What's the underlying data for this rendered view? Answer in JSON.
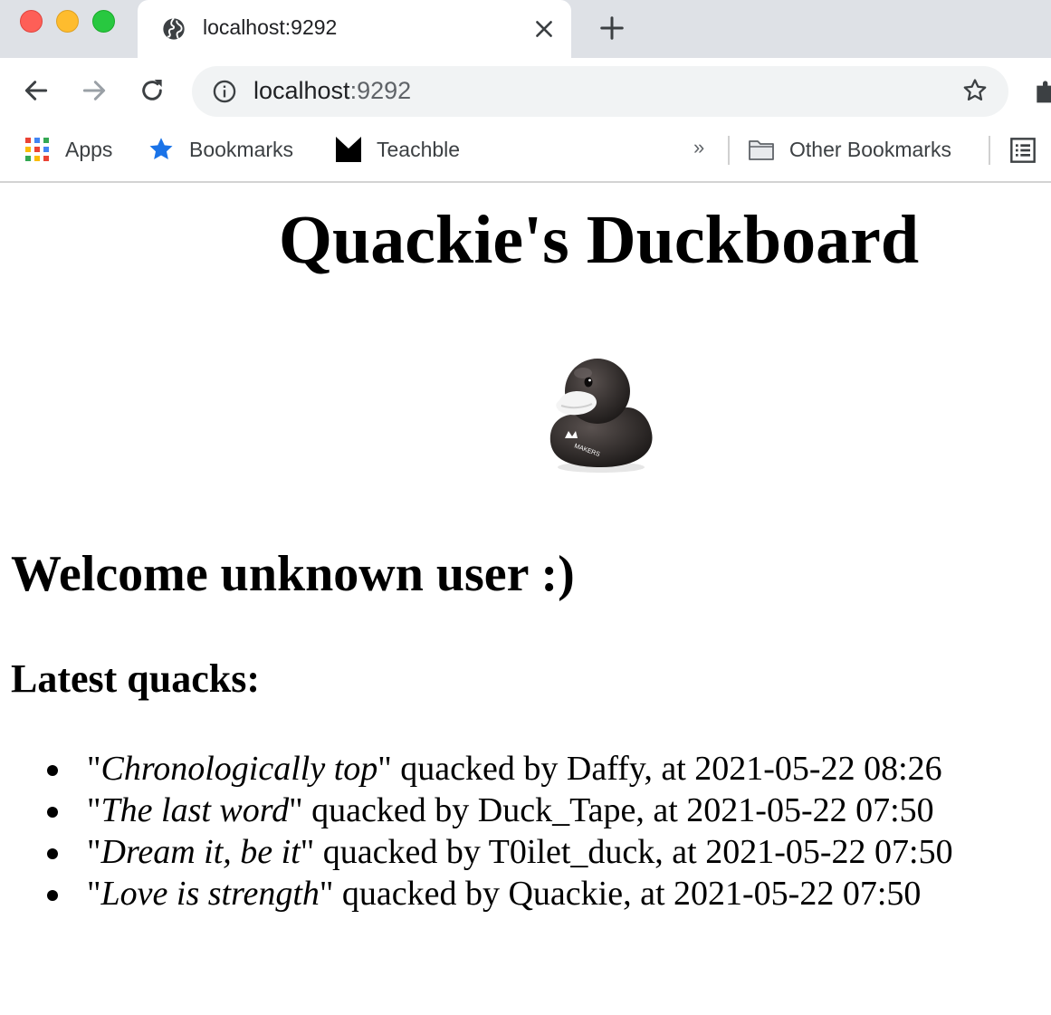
{
  "browser": {
    "tab": {
      "title": "localhost:9292"
    },
    "address_bar": {
      "host": "localhost",
      "port": ":9292"
    },
    "bookmarks_bar": {
      "items": [
        {
          "label": "Apps",
          "icon": "apps-grid-icon"
        },
        {
          "label": "Bookmarks",
          "icon": "star-icon"
        },
        {
          "label": "Teachble",
          "icon": "teachable-logo-icon"
        }
      ],
      "overflow": "»",
      "other": {
        "label": "Other Bookmarks",
        "icon": "folder-icon"
      }
    },
    "colors": {
      "tabstrip": "#dee1e6",
      "omnibox": "#f1f3f4",
      "star_blue": "#1a73e8"
    }
  },
  "page": {
    "title": "Quackie's Duckboard",
    "welcome": "Welcome unknown user :)",
    "latest_heading": "Latest quacks:",
    "quacks": [
      {
        "open_quote": "\"",
        "text": "Chronologically top",
        "close_quote": "\"",
        "rest": " quacked by Daffy, at 2021-05-22 08:26"
      },
      {
        "open_quote": "\"",
        "text": "The last word",
        "close_quote": "\"",
        "rest": " quacked by Duck_Tape, at 2021-05-22 07:50"
      },
      {
        "open_quote": "\"",
        "text": "Dream it, be it",
        "close_quote": "\"",
        "rest": " quacked by T0ilet_duck, at 2021-05-22 07:50"
      },
      {
        "open_quote": "\"",
        "text": "Love is strength",
        "close_quote": "\"",
        "rest": " quacked by Quackie, at 2021-05-22 07:50"
      }
    ],
    "duck_logo_text": "MAKERS"
  }
}
